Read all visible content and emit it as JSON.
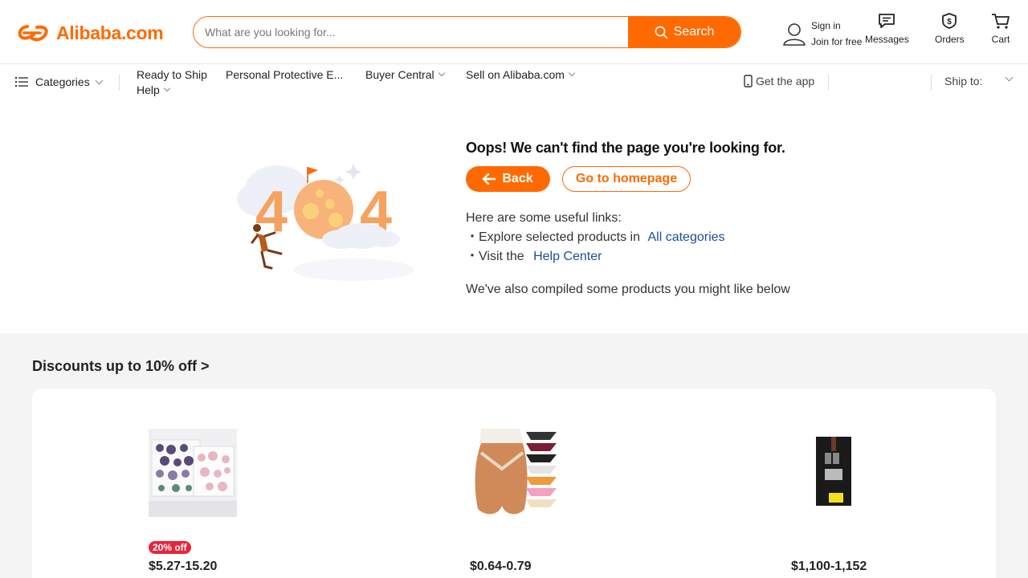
{
  "header": {
    "logo_text": "Alibaba.com",
    "search_placeholder": "What are you looking for...",
    "search_button": "Search",
    "signin_label": "Sign in",
    "join_label": "Join for free",
    "messages_label": "Messages",
    "orders_label": "Orders",
    "cart_label": "Cart",
    "brand_color": "#ff6a00"
  },
  "nav": {
    "categories": "Categories",
    "ready_to_ship": "Ready to Ship",
    "ppe": "Personal Protective E...",
    "buyer_central": "Buyer Central",
    "sell": "Sell on Alibaba.com",
    "help": "Help",
    "get_app": "Get the app",
    "ship_to": "Ship to:"
  },
  "error": {
    "illustration_text": "404",
    "title": "Oops! We can't find the page you're looking for.",
    "back_button": "Back",
    "home_button": "Go to homepage",
    "links_intro": "Here are some useful links:",
    "link1_prefix": "・Explore selected products in",
    "link1_text": "All categories",
    "link2_prefix": "・Visit the",
    "link2_text": "Help Center",
    "compiled_text": "We've also compiled some products you might like below"
  },
  "discounts": {
    "title": "Discounts up to 10%  off >",
    "products": [
      {
        "badge": "20% off",
        "price": "$5.27-15.20",
        "image": "gemstone-box-image"
      },
      {
        "badge": "",
        "price": "$0.64-0.79",
        "image": "underwear-image"
      },
      {
        "badge": "",
        "price": "$1,100-1,152",
        "image": "device-image"
      }
    ]
  }
}
